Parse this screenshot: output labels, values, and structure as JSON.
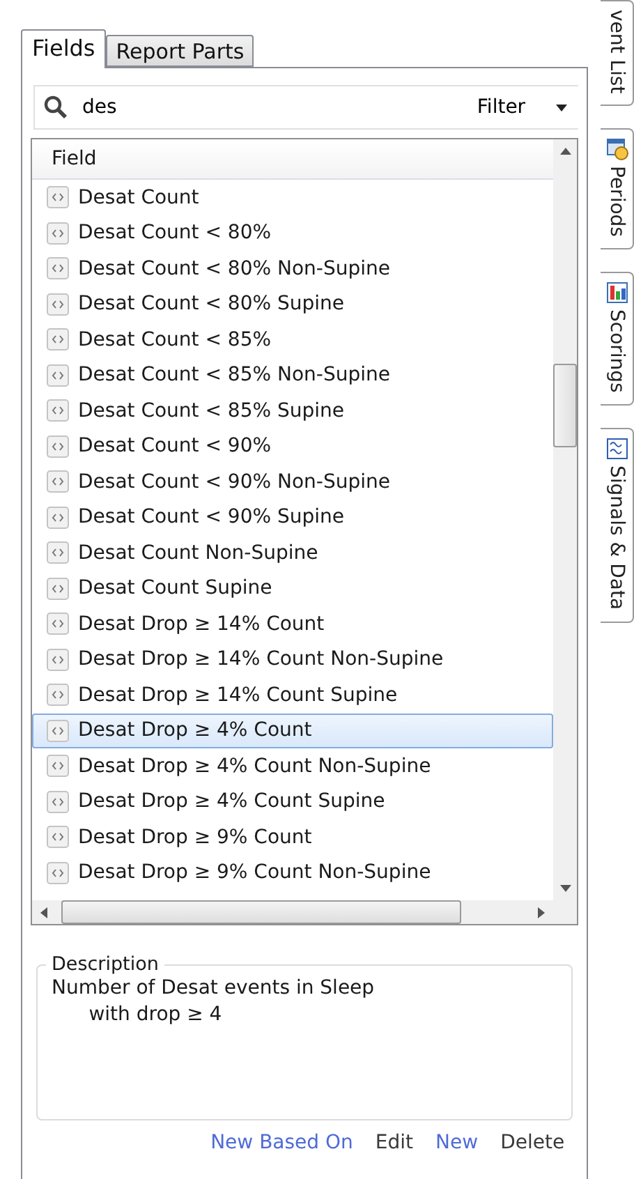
{
  "tabs": [
    {
      "label": "Fields",
      "selected": true
    },
    {
      "label": "Report Parts",
      "selected": false
    }
  ],
  "search": {
    "value": "des",
    "filter_label": "Filter"
  },
  "table": {
    "column": "Field",
    "rows": [
      {
        "label": "Desat Count",
        "selected": false
      },
      {
        "label": "Desat Count < 80%",
        "selected": false
      },
      {
        "label": "Desat Count < 80% Non-Supine",
        "selected": false
      },
      {
        "label": "Desat Count < 80% Supine",
        "selected": false
      },
      {
        "label": "Desat Count < 85%",
        "selected": false
      },
      {
        "label": "Desat Count < 85% Non-Supine",
        "selected": false
      },
      {
        "label": "Desat Count < 85% Supine",
        "selected": false
      },
      {
        "label": "Desat Count < 90%",
        "selected": false
      },
      {
        "label": "Desat Count < 90% Non-Supine",
        "selected": false
      },
      {
        "label": "Desat Count < 90% Supine",
        "selected": false
      },
      {
        "label": "Desat Count Non-Supine",
        "selected": false
      },
      {
        "label": "Desat Count Supine",
        "selected": false
      },
      {
        "label": "Desat Drop ≥ 14% Count",
        "selected": false
      },
      {
        "label": "Desat Drop ≥ 14% Count Non-Supine",
        "selected": false
      },
      {
        "label": "Desat Drop ≥ 14% Count Supine",
        "selected": false
      },
      {
        "label": "Desat Drop ≥ 4% Count",
        "selected": true
      },
      {
        "label": "Desat Drop ≥ 4% Count Non-Supine",
        "selected": false
      },
      {
        "label": "Desat Drop ≥ 4% Count Supine",
        "selected": false
      },
      {
        "label": "Desat Drop ≥ 9% Count",
        "selected": false
      },
      {
        "label": "Desat Drop ≥ 9% Count Non-Supine",
        "selected": false
      }
    ]
  },
  "description": {
    "title": "Description",
    "text": "Number of Desat events in Sleep\n      with drop ≥ 4"
  },
  "actions": [
    {
      "label": "New Based On",
      "kind": "link"
    },
    {
      "label": "Edit",
      "kind": "plain"
    },
    {
      "label": "New",
      "kind": "link"
    },
    {
      "label": "Delete",
      "kind": "plain"
    }
  ],
  "side_tabs": [
    {
      "label": "vent List",
      "kind": "plain"
    },
    {
      "label": "Periods",
      "kind": "periods"
    },
    {
      "label": "Scorings",
      "kind": "scorings"
    },
    {
      "label": "Signals & Data",
      "kind": "signals"
    }
  ]
}
